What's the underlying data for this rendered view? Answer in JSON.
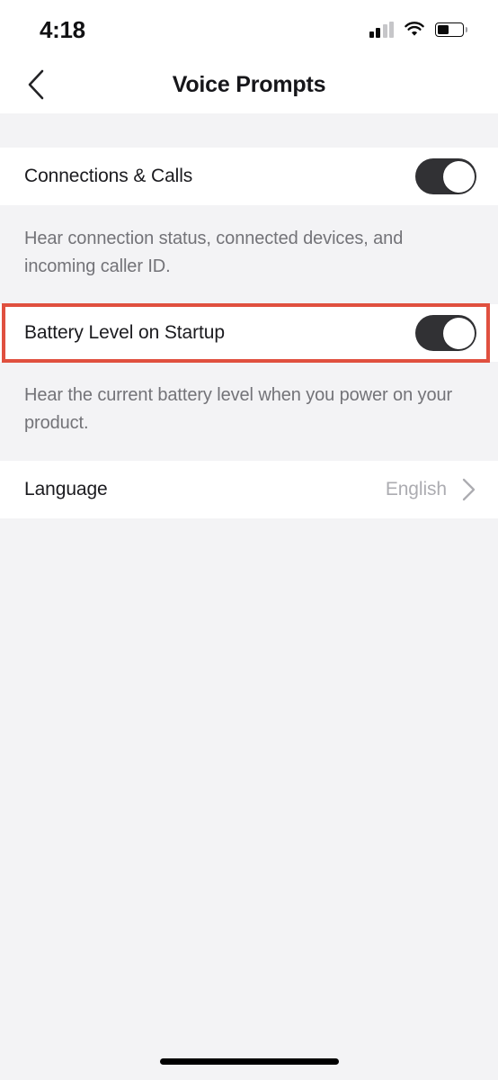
{
  "status_bar": {
    "time": "4:18",
    "signal_icon": "cellular-signal-icon",
    "signal_bars_filled": 2,
    "signal_bars_total": 4,
    "wifi_icon": "wifi-icon",
    "battery_icon": "battery-icon",
    "battery_level_percent": 45
  },
  "nav": {
    "back_icon": "chevron-left-icon",
    "title": "Voice Prompts"
  },
  "settings": [
    {
      "label": "Connections & Calls",
      "control": "toggle",
      "toggle_state": "on",
      "description": "Hear connection status, connected devices, and incoming caller ID.",
      "highlighted": false
    },
    {
      "label": "Battery Level on Startup",
      "control": "toggle",
      "toggle_state": "on",
      "description": "Hear the current battery level when you power on your product.",
      "highlighted": true
    },
    {
      "label": "Language",
      "control": "value-chevron",
      "value": "English",
      "chevron_icon": "chevron-right-icon",
      "highlighted": false
    }
  ],
  "colors": {
    "highlight_red": "#E0503F",
    "toggle_on": "#313134",
    "page_background": "#F3F3F5",
    "row_background": "#FFFFFF",
    "description_text": "#737378",
    "value_text": "#ACACB1"
  },
  "home_indicator": "home-indicator"
}
